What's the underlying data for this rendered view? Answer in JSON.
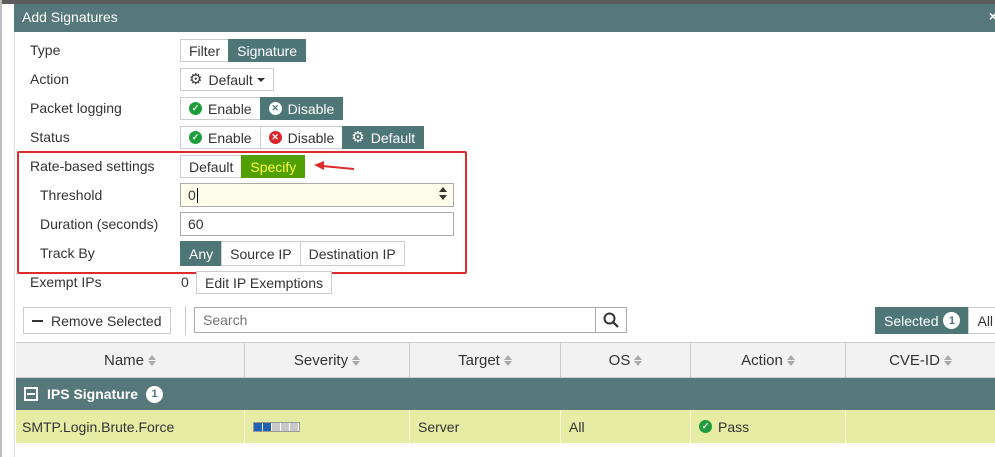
{
  "dialog": {
    "title": "Add Signatures",
    "close": "×"
  },
  "form": {
    "type": {
      "label": "Type",
      "options": [
        "Filter",
        "Signature"
      ],
      "selected": "Signature"
    },
    "action": {
      "label": "Action",
      "value": "Default"
    },
    "packet_logging": {
      "label": "Packet logging",
      "options": [
        "Enable",
        "Disable"
      ],
      "selected": "Disable"
    },
    "status": {
      "label": "Status",
      "options": [
        "Enable",
        "Disable",
        "Default"
      ],
      "selected": "Default"
    },
    "rate_based": {
      "label": "Rate-based settings",
      "options": [
        "Default",
        "Specify"
      ],
      "selected": "Specify"
    },
    "threshold": {
      "label": "Threshold",
      "value": "0"
    },
    "duration": {
      "label": "Duration (seconds)",
      "value": "60"
    },
    "track_by": {
      "label": "Track By",
      "options": [
        "Any",
        "Source IP",
        "Destination IP"
      ],
      "selected": "Any"
    },
    "exempt_ips": {
      "label": "Exempt IPs",
      "count": "0",
      "button": "Edit IP Exemptions"
    }
  },
  "toolbar": {
    "remove_selected": "Remove Selected",
    "search_placeholder": "Search",
    "selected_label": "Selected",
    "selected_count": "1",
    "all_label": "All"
  },
  "table": {
    "columns": [
      "Name",
      "Severity",
      "Target",
      "OS",
      "Action",
      "CVE-ID"
    ],
    "group": {
      "name": "IPS Signature",
      "count": "1"
    },
    "rows": [
      {
        "name": "SMTP.Login.Brute.Force",
        "severity_level": 2,
        "severity_max": 5,
        "target": "Server",
        "os": "All",
        "action": "Pass",
        "cve": ""
      }
    ]
  },
  "colors": {
    "header": "#56787a",
    "selected": "#4e7677",
    "specify_bg": "#4fa000",
    "specify_text": "#ffff3a",
    "highlight_box": "#dd2c2c",
    "row_bg": "#e6eca4"
  }
}
